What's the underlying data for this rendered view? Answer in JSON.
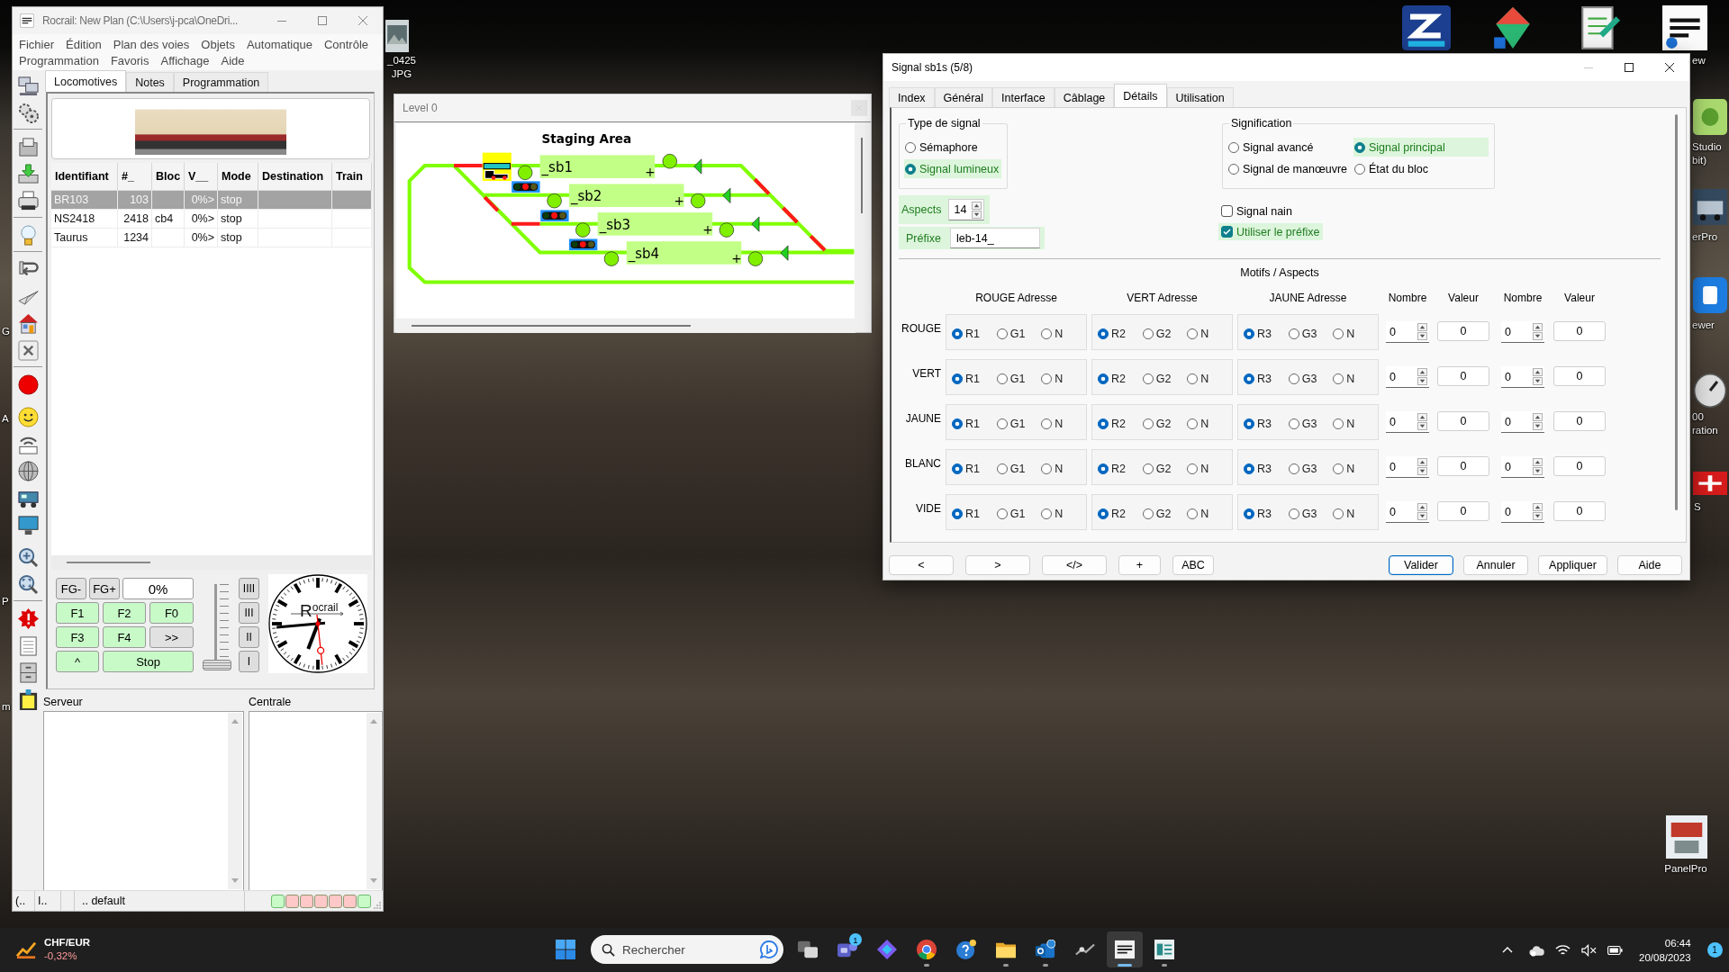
{
  "desktop": {
    "icon_labels": [
      {
        "lines": [
          "_0425",
          "JPG"
        ]
      },
      {
        "lines": [
          "ew"
        ]
      },
      {
        "lines": [
          "Studio",
          "bit)"
        ]
      },
      {
        "lines": [
          "erPro"
        ]
      },
      {
        "lines": [
          "ewer"
        ]
      },
      {
        "lines": [
          "00",
          "ration"
        ]
      },
      {
        "lines": [
          "S"
        ]
      },
      {
        "lines": [
          "PanelPro"
        ]
      },
      {
        "lines": [
          "G"
        ]
      },
      {
        "lines": [
          "A"
        ]
      },
      {
        "lines": [
          "P"
        ]
      },
      {
        "lines": [
          "m"
        ]
      }
    ]
  },
  "main_window": {
    "title": "Rocrail: New Plan (C:\\Users\\j-pca\\OneDri...",
    "menu_rows": [
      [
        "Fichier",
        "Édition",
        "Plan des voies",
        "Objets",
        "Automatique",
        "Contrôle"
      ],
      [
        "Programmation",
        "Favoris",
        "Affichage",
        "Aide"
      ]
    ],
    "tabs": [
      {
        "label": "Locomotives",
        "selected": true
      },
      {
        "label": "Notes",
        "selected": false
      },
      {
        "label": "Programmation",
        "selected": false
      }
    ],
    "loco_table": {
      "columns": [
        "Identifiant",
        "#_",
        "Bloc",
        "V__",
        "Mode",
        "Destination",
        "Train"
      ],
      "rows": [
        {
          "identifiant": "BR103",
          "number": "103",
          "speed": "0%>",
          "mode": "stop",
          "selected": true
        },
        {
          "identifiant": "NS2418",
          "number": "2418",
          "bloc": "cb4",
          "speed": "0%>",
          "mode": "stop",
          "selected": false
        },
        {
          "identifiant": "Taurus",
          "number": "1234",
          "speed": "0%>",
          "mode": "stop",
          "selected": false
        }
      ]
    },
    "throttle": {
      "top_buttons": [
        "FG-",
        "FG+"
      ],
      "speed": "0%",
      "function_buttons": [
        {
          "label": "F1",
          "highlighted": true
        },
        {
          "label": "F2",
          "highlighted": true
        },
        {
          "label": "F0",
          "highlighted": true
        },
        {
          "label": "F3",
          "highlighted": true
        },
        {
          "label": "F4",
          "highlighted": true
        },
        {
          "label": ">>",
          "highlighted": false
        },
        {
          "label": "^",
          "highlighted": true
        },
        {
          "label": "Stop",
          "highlighted": true
        }
      ],
      "speed_slider": {
        "level": 0
      },
      "step_buttons": [
        "IIII",
        "III",
        "II",
        "I"
      ]
    },
    "clock": {
      "brand": "R$^{ocrail}$"
    },
    "log_panels": [
      {
        "label": "Serveur"
      },
      {
        "label": "Centrale"
      }
    ],
    "status_bar": {
      "fields": [
        "(..",
        "I..",
        ".. default"
      ],
      "indicators": [
        {
          "color": "#c8fac8"
        },
        {
          "color": "#ffc8c8"
        },
        {
          "color": "#ffc8c8"
        },
        {
          "color": "#ffc8c8"
        },
        {
          "color": "#ffc8c8"
        },
        {
          "color": "#ffc8c8"
        },
        {
          "color": "#c8fac8"
        }
      ]
    }
  },
  "level_window": {
    "title": "Level 0",
    "layout_title": "Staging Area",
    "blocks": [
      {
        "label": "_sb1",
        "sign": "+",
        "occupied": true
      },
      {
        "label": "_sb2",
        "sign": "+",
        "occupied": false
      },
      {
        "label": "_sb3",
        "sign": "+",
        "occupied": false
      },
      {
        "label": "_sb4",
        "sign": "+",
        "occupied": false
      }
    ],
    "signals": [
      {
        "stop": true
      },
      {
        "stop": true
      },
      {
        "stop": true
      }
    ]
  },
  "signal_dialog": {
    "title": "Signal sb1s (5/8)",
    "tabs": [
      {
        "label": "Index",
        "selected": false
      },
      {
        "label": "Général",
        "selected": false
      },
      {
        "label": "Interface",
        "selected": false
      },
      {
        "label": "Câblage",
        "selected": false
      },
      {
        "label": "Détails",
        "selected": true
      },
      {
        "label": "Utilisation",
        "selected": false
      }
    ],
    "signal_type": {
      "title": "Type de signal",
      "options": [
        {
          "label": "Sémaphore",
          "selected": false,
          "highlighted": false
        },
        {
          "label": "Signal lumineux",
          "selected": true,
          "highlighted": true
        }
      ]
    },
    "meaning": {
      "title": "Signification",
      "options": [
        {
          "label": "Signal avancé",
          "selected": false,
          "highlighted": false
        },
        {
          "label": "Signal principal",
          "selected": true,
          "highlighted": true
        },
        {
          "label": "Signal de manœuvre",
          "selected": false,
          "highlighted": false
        },
        {
          "label": "État du bloc",
          "selected": false,
          "highlighted": false
        }
      ]
    },
    "aspects": {
      "label": "Aspects",
      "value": "14",
      "highlighted": true
    },
    "prefix": {
      "label": "Préfixe",
      "value": "leb-14_",
      "highlighted": true
    },
    "checkboxes": [
      {
        "label": "Signal nain",
        "checked": false,
        "highlighted": false
      },
      {
        "label": "Utiliser le préfixe",
        "checked": true,
        "highlighted": true
      }
    ],
    "patterns": {
      "title": "Motifs / Aspects",
      "columns": [
        "ROUGE Adresse",
        "VERT Adresse",
        "JAUNE Adresse",
        "Nombre",
        "Valeur",
        "Nombre",
        "Valeur"
      ],
      "rows": [
        {
          "label": "ROUGE",
          "groups": [
            {
              "options": [
                {
                  "label": "R1",
                  "selected": true
                },
                {
                  "label": "G1",
                  "selected": false
                },
                {
                  "label": "N",
                  "selected": false
                }
              ]
            },
            {
              "options": [
                {
                  "label": "R2",
                  "selected": true
                },
                {
                  "label": "G2",
                  "selected": false
                },
                {
                  "label": "N",
                  "selected": false
                }
              ]
            },
            {
              "options": [
                {
                  "label": "R3",
                  "selected": true
                },
                {
                  "label": "G3",
                  "selected": false
                },
                {
                  "label": "N",
                  "selected": false
                }
              ]
            }
          ],
          "pairs": [
            {
              "number": "0",
              "value": "0"
            },
            {
              "number": "0",
              "value": "0"
            }
          ]
        },
        {
          "label": "VERT",
          "groups": [
            {
              "options": [
                {
                  "label": "R1",
                  "selected": true
                },
                {
                  "label": "G1",
                  "selected": false
                },
                {
                  "label": "N",
                  "selected": false
                }
              ]
            },
            {
              "options": [
                {
                  "label": "R2",
                  "selected": true
                },
                {
                  "label": "G2",
                  "selected": false
                },
                {
                  "label": "N",
                  "selected": false
                }
              ]
            },
            {
              "options": [
                {
                  "label": "R3",
                  "selected": true
                },
                {
                  "label": "G3",
                  "selected": false
                },
                {
                  "label": "N",
                  "selected": false
                }
              ]
            }
          ],
          "pairs": [
            {
              "number": "0",
              "value": "0"
            },
            {
              "number": "0",
              "value": "0"
            }
          ]
        },
        {
          "label": "JAUNE",
          "groups": [
            {
              "options": [
                {
                  "label": "R1",
                  "selected": true
                },
                {
                  "label": "G1",
                  "selected": false
                },
                {
                  "label": "N",
                  "selected": false
                }
              ]
            },
            {
              "options": [
                {
                  "label": "R2",
                  "selected": true
                },
                {
                  "label": "G2",
                  "selected": false
                },
                {
                  "label": "N",
                  "selected": false
                }
              ]
            },
            {
              "options": [
                {
                  "label": "R3",
                  "selected": true
                },
                {
                  "label": "G3",
                  "selected": false
                },
                {
                  "label": "N",
                  "selected": false
                }
              ]
            }
          ],
          "pairs": [
            {
              "number": "0",
              "value": "0"
            },
            {
              "number": "0",
              "value": "0"
            }
          ]
        },
        {
          "label": "BLANC",
          "groups": [
            {
              "options": [
                {
                  "label": "R1",
                  "selected": true
                },
                {
                  "label": "G1",
                  "selected": false
                },
                {
                  "label": "N",
                  "selected": false
                }
              ]
            },
            {
              "options": [
                {
                  "label": "R2",
                  "selected": true
                },
                {
                  "label": "G2",
                  "selected": false
                },
                {
                  "label": "N",
                  "selected": false
                }
              ]
            },
            {
              "options": [
                {
                  "label": "R3",
                  "selected": true
                },
                {
                  "label": "G3",
                  "selected": false
                },
                {
                  "label": "N",
                  "selected": false
                }
              ]
            }
          ],
          "pairs": [
            {
              "number": "0",
              "value": "0"
            },
            {
              "number": "0",
              "value": "0"
            }
          ]
        },
        {
          "label": "VIDE",
          "groups": [
            {
              "options": [
                {
                  "label": "R1",
                  "selected": true
                },
                {
                  "label": "G1",
                  "selected": false
                },
                {
                  "label": "N",
                  "selected": false
                }
              ]
            },
            {
              "options": [
                {
                  "label": "R2",
                  "selected": true
                },
                {
                  "label": "G2",
                  "selected": false
                },
                {
                  "label": "N",
                  "selected": false
                }
              ]
            },
            {
              "options": [
                {
                  "label": "R3",
                  "selected": true
                },
                {
                  "label": "G3",
                  "selected": false
                },
                {
                  "label": "N",
                  "selected": false
                }
              ]
            }
          ],
          "pairs": [
            {
              "number": "0",
              "value": "0"
            },
            {
              "number": "0",
              "value": "0"
            }
          ]
        }
      ]
    },
    "nav_buttons": [
      "<",
      ">",
      "</>",
      "+",
      "ABC"
    ],
    "action_buttons": [
      {
        "label": "Valider",
        "default": true
      },
      {
        "label": "Annuler",
        "default": false
      },
      {
        "label": "Appliquer",
        "default": false
      },
      {
        "label": "Aide",
        "default": false
      }
    ]
  },
  "taskbar": {
    "widget": {
      "title": "CHF/EUR",
      "value": "-0,32%",
      "negative": true
    },
    "search": {
      "placeholder": "Rechercher"
    },
    "apps": [
      {
        "kind": "start",
        "running": false,
        "active": false
      },
      {
        "kind": "taskview",
        "running": false,
        "active": false
      },
      {
        "kind": "chat",
        "badge": "1",
        "running": false,
        "active": false
      },
      {
        "kind": "copilot",
        "running": false,
        "active": false
      },
      {
        "kind": "browser",
        "running": true,
        "active": false
      },
      {
        "kind": "help",
        "running": false,
        "active": false
      },
      {
        "kind": "files",
        "running": true,
        "active": false
      },
      {
        "kind": "mail",
        "running": true,
        "active": false
      },
      {
        "kind": "tool",
        "running": false,
        "active": false
      },
      {
        "kind": "rocrail",
        "running": true,
        "active": true
      },
      {
        "kind": "viewer",
        "running": true,
        "active": false
      }
    ],
    "time": "06:44",
    "date": "20/08/2023",
    "notifications": "1"
  }
}
